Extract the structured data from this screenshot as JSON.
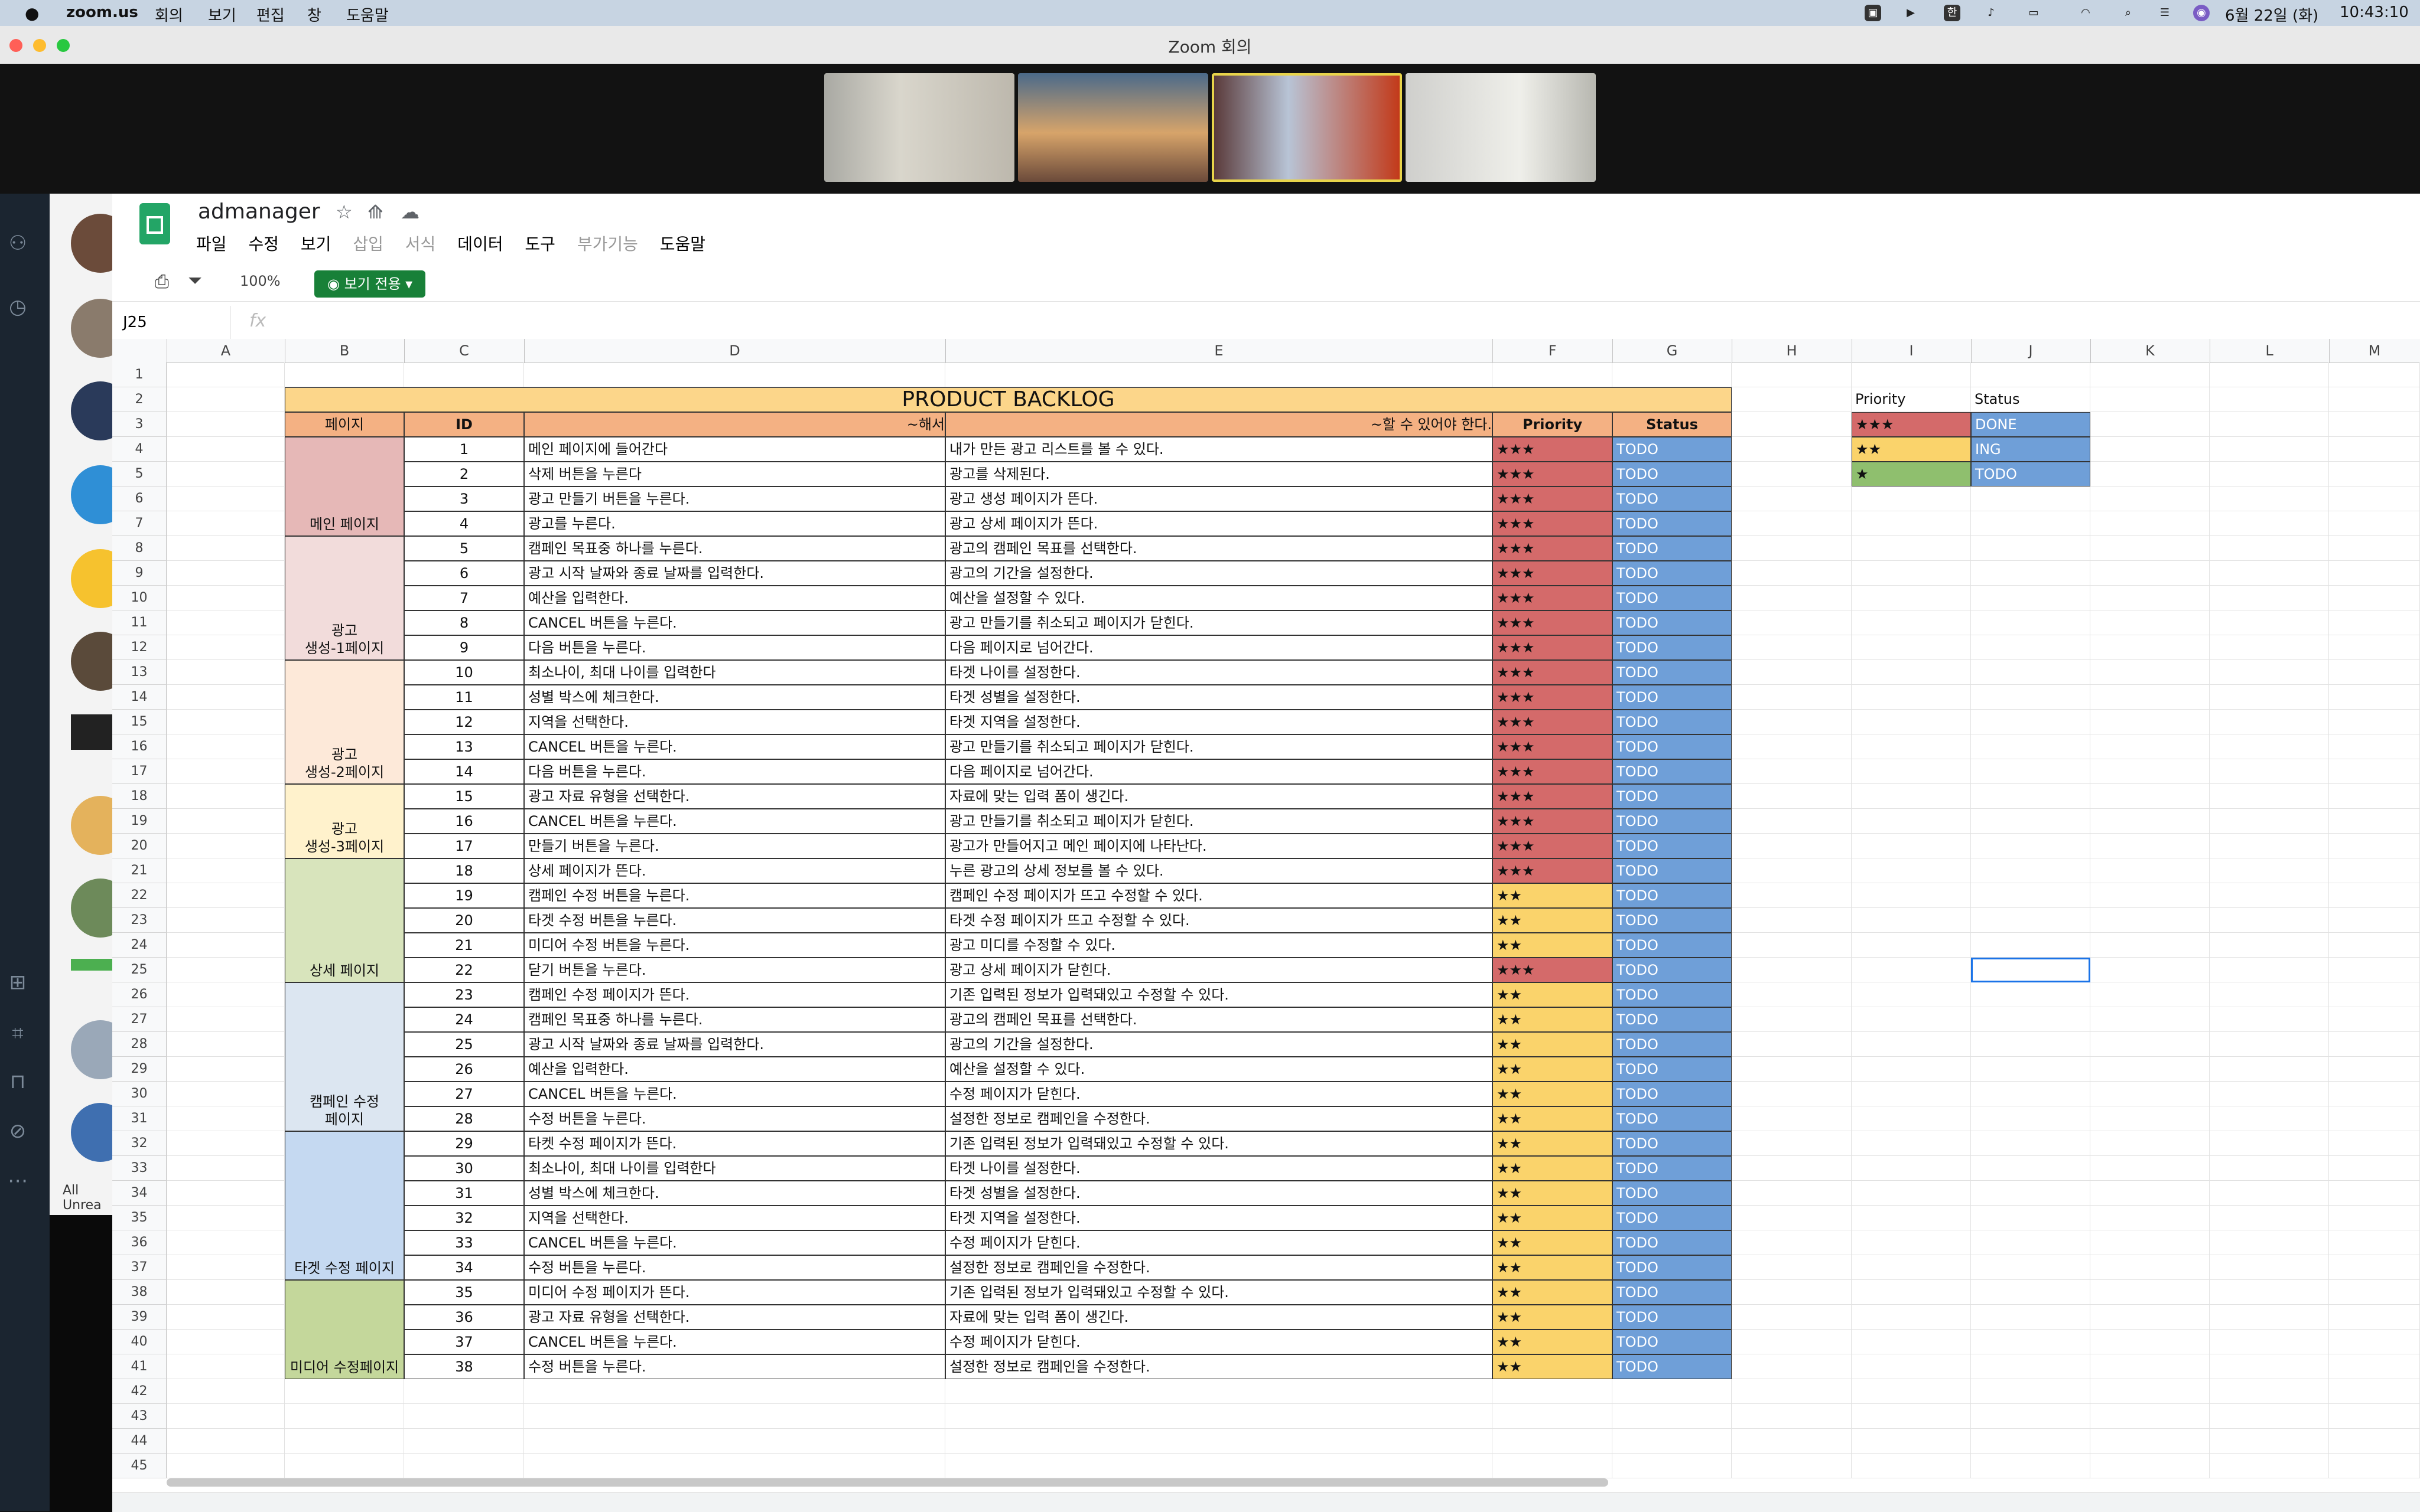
{
  "menubar": {
    "app": "zoom.us",
    "items": [
      "회의",
      "보기",
      "편집",
      "창",
      "도움말"
    ],
    "date": "6월 22일 (화)",
    "time": "10:43:10"
  },
  "window": {
    "title": "Zoom 회의"
  },
  "slack": {
    "footer": "All Unrea"
  },
  "sheet": {
    "doc_name": "admanager",
    "menus": [
      "파일",
      "수정",
      "보기",
      "삽입",
      "서식",
      "데이터",
      "도구",
      "부가기능",
      "도움말"
    ],
    "zoom": "100%",
    "view_only": "보기 전용",
    "name_box": "J25",
    "fx": "fx",
    "columns": [
      "A",
      "B",
      "C",
      "D",
      "E",
      "F",
      "G",
      "H",
      "I",
      "J",
      "K",
      "L",
      "M"
    ],
    "row_count": 45,
    "title": "PRODUCT BACKLOG",
    "headers": {
      "page": "페이지",
      "id": "ID",
      "action": "~해서",
      "result": "~할 수 있어야 한다.",
      "priority": "Priority",
      "status": "Status"
    },
    "page_groups": [
      {
        "label": "메인 페이지",
        "color": "#e6b8b7"
      },
      {
        "label": "광고\n생성-1페이지",
        "color": "#f2dcdb"
      },
      {
        "label": "광고\n생성-2페이지",
        "color": "#fde9d9"
      },
      {
        "label": "광고\n생성-3페이지",
        "color": "#fff2cc"
      },
      {
        "label": "상세 페이지",
        "color": "#d8e4bc"
      },
      {
        "label": "캠페인 수정\n페이지",
        "color": "#dce6f1"
      },
      {
        "label": "타겟 수정 페이지",
        "color": "#c5d9f1"
      },
      {
        "label": "미디어 수정페이지",
        "color": "#c4d79b"
      }
    ],
    "rows": [
      {
        "id": "1",
        "action": "메인 페이지에 들어간다",
        "result": "내가 만든 광고 리스트를 볼 수 있다.",
        "priority": "★★★",
        "status": "TODO"
      },
      {
        "id": "2",
        "action": "삭제 버튼을 누른다",
        "result": "광고를 삭제된다.",
        "priority": "★★★",
        "status": "TODO"
      },
      {
        "id": "3",
        "action": "광고 만들기 버튼을 누른다.",
        "result": "광고 생성 페이지가 뜬다.",
        "priority": "★★★",
        "status": "TODO"
      },
      {
        "id": "4",
        "action": "광고를 누른다.",
        "result": "광고 상세 페이지가 뜬다.",
        "priority": "★★★",
        "status": "TODO"
      },
      {
        "id": "5",
        "action": "캠페인 목표중 하나를 누른다.",
        "result": "광고의 캠페인 목표를 선택한다.",
        "priority": "★★★",
        "status": "TODO"
      },
      {
        "id": "6",
        "action": "광고 시작 날짜와 종료 날짜를 입력한다.",
        "result": "광고의 기간을 설정한다.",
        "priority": "★★★",
        "status": "TODO"
      },
      {
        "id": "7",
        "action": "예산을 입력한다.",
        "result": "예산을 설정할 수 있다.",
        "priority": "★★★",
        "status": "TODO"
      },
      {
        "id": "8",
        "action": "CANCEL 버튼을 누른다.",
        "result": "광고 만들기를 취소되고 페이지가 닫힌다.",
        "priority": "★★★",
        "status": "TODO"
      },
      {
        "id": "9",
        "action": "다음 버튼을 누른다.",
        "result": "다음 페이지로 넘어간다.",
        "priority": "★★★",
        "status": "TODO"
      },
      {
        "id": "10",
        "action": "최소나이, 최대 나이를 입력한다",
        "result": "타겟 나이를 설정한다.",
        "priority": "★★★",
        "status": "TODO"
      },
      {
        "id": "11",
        "action": "성별 박스에 체크한다.",
        "result": "타겟 성별을 설정한다.",
        "priority": "★★★",
        "status": "TODO"
      },
      {
        "id": "12",
        "action": "지역을 선택한다.",
        "result": "타겟 지역을 설정한다.",
        "priority": "★★★",
        "status": "TODO"
      },
      {
        "id": "13",
        "action": "CANCEL 버튼을 누른다.",
        "result": "광고 만들기를 취소되고 페이지가 닫힌다.",
        "priority": "★★★",
        "status": "TODO"
      },
      {
        "id": "14",
        "action": "다음 버튼을 누른다.",
        "result": "다음 페이지로 넘어간다.",
        "priority": "★★★",
        "status": "TODO"
      },
      {
        "id": "15",
        "action": "광고 자료 유형을 선택한다.",
        "result": "자료에 맞는 입력 폼이 생긴다.",
        "priority": "★★★",
        "status": "TODO"
      },
      {
        "id": "16",
        "action": "CANCEL 버튼을 누른다.",
        "result": "광고 만들기를 취소되고 페이지가 닫힌다.",
        "priority": "★★★",
        "status": "TODO"
      },
      {
        "id": "17",
        "action": "만들기 버튼을 누른다.",
        "result": "광고가 만들어지고 메인 페이지에 나타난다.",
        "priority": "★★★",
        "status": "TODO"
      },
      {
        "id": "18",
        "action": "상세 페이지가 뜬다.",
        "result": "누른 광고의 상세 정보를 볼 수 있다.",
        "priority": "★★★",
        "status": "TODO"
      },
      {
        "id": "19",
        "action": "캠페인 수정 버튼을 누른다.",
        "result": "캠페인 수정 페이지가 뜨고 수정할 수 있다.",
        "priority": "★★",
        "status": "TODO"
      },
      {
        "id": "20",
        "action": "타겟 수정 버튼을 누른다.",
        "result": "타겟 수정 페이지가 뜨고 수정할 수 있다.",
        "priority": "★★",
        "status": "TODO"
      },
      {
        "id": "21",
        "action": "미디어 수정 버튼을 누른다.",
        "result": "광고 미디를 수정할 수 있다.",
        "priority": "★★",
        "status": "TODO"
      },
      {
        "id": "22",
        "action": "닫기 버튼을 누른다.",
        "result": "광고 상세 페이지가 닫힌다.",
        "priority": "★★★",
        "status": "TODO"
      },
      {
        "id": "23",
        "action": "캠페인 수정 페이지가 뜬다.",
        "result": "기존 입력된 정보가 입력돼있고 수정할 수 있다.",
        "priority": "★★",
        "status": "TODO"
      },
      {
        "id": "24",
        "action": "캠페인 목표중 하나를 누른다.",
        "result": "광고의 캠페인 목표를 선택한다.",
        "priority": "★★",
        "status": "TODO"
      },
      {
        "id": "25",
        "action": "광고 시작 날짜와 종료 날짜를 입력한다.",
        "result": "광고의 기간을 설정한다.",
        "priority": "★★",
        "status": "TODO"
      },
      {
        "id": "26",
        "action": "예산을 입력한다.",
        "result": "예산을 설정할 수 있다.",
        "priority": "★★",
        "status": "TODO"
      },
      {
        "id": "27",
        "action": "CANCEL 버튼을 누른다.",
        "result": "수정 페이지가 닫힌다.",
        "priority": "★★",
        "status": "TODO"
      },
      {
        "id": "28",
        "action": "수정 버튼을 누른다.",
        "result": "설정한 정보로 캠페인을 수정한다.",
        "priority": "★★",
        "status": "TODO"
      },
      {
        "id": "29",
        "action": "타켓 수정 페이지가 뜬다.",
        "result": "기존 입력된 정보가 입력돼있고 수정할 수 있다.",
        "priority": "★★",
        "status": "TODO"
      },
      {
        "id": "30",
        "action": "최소나이, 최대 나이를 입력한다",
        "result": "타겟 나이를 설정한다.",
        "priority": "★★",
        "status": "TODO"
      },
      {
        "id": "31",
        "action": "성별 박스에 체크한다.",
        "result": "타겟 성별을 설정한다.",
        "priority": "★★",
        "status": "TODO"
      },
      {
        "id": "32",
        "action": "지역을 선택한다.",
        "result": "타겟 지역을 설정한다.",
        "priority": "★★",
        "status": "TODO"
      },
      {
        "id": "33",
        "action": "CANCEL 버튼을 누른다.",
        "result": "수정 페이지가 닫힌다.",
        "priority": "★★",
        "status": "TODO"
      },
      {
        "id": "34",
        "action": "수정 버튼을 누른다.",
        "result": "설정한 정보로 캠페인을 수정한다.",
        "priority": "★★",
        "status": "TODO"
      },
      {
        "id": "35",
        "action": "미디어 수정 페이지가 뜬다.",
        "result": "기존 입력된 정보가 입력돼있고 수정할 수 있다.",
        "priority": "★★",
        "status": "TODO"
      },
      {
        "id": "36",
        "action": "광고 자료 유형을 선택한다.",
        "result": "자료에 맞는 입력 폼이 생긴다.",
        "priority": "★★",
        "status": "TODO"
      },
      {
        "id": "37",
        "action": "CANCEL 버튼을 누른다.",
        "result": "수정 페이지가 닫힌다.",
        "priority": "★★",
        "status": "TODO"
      },
      {
        "id": "38",
        "action": "수정 버튼을 누른다.",
        "result": "설정한 정보로 캠페인을 수정한다.",
        "priority": "★★",
        "status": "TODO"
      }
    ],
    "legend": {
      "priority_header": "Priority",
      "status_header": "Status",
      "items": [
        {
          "priority": "★★★",
          "status": "DONE"
        },
        {
          "priority": "★★",
          "status": "ING"
        },
        {
          "priority": "★",
          "status": "TODO"
        }
      ]
    },
    "colors": {
      "title_bg": "#fcd68a",
      "header_bg": "#f4b183",
      "p3": "#d46a6a",
      "p2": "#fad36b",
      "p1": "#8fbf6e",
      "status_bg": "#6f9fd8"
    }
  }
}
